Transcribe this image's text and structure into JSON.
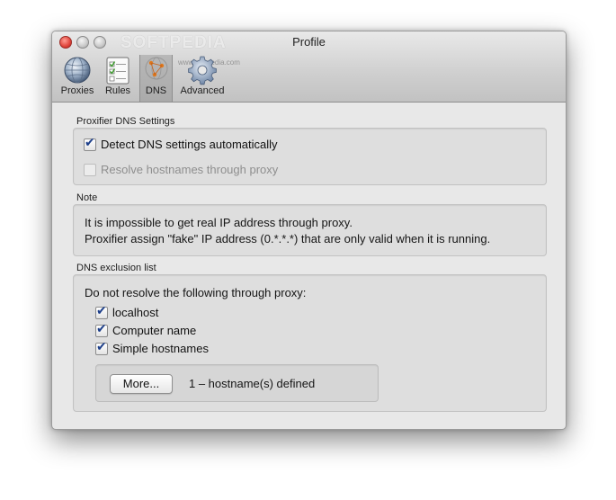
{
  "window": {
    "title": "Profile",
    "watermark": "SOFTPEDIA",
    "watermark_small": "www.softpedia.com"
  },
  "toolbar": {
    "items": [
      {
        "label": "Proxies",
        "icon": "globe-icon",
        "selected": false
      },
      {
        "label": "Rules",
        "icon": "checklist-icon",
        "selected": false
      },
      {
        "label": "DNS",
        "icon": "dns-icon",
        "selected": true
      },
      {
        "label": "Advanced",
        "icon": "gear-icon",
        "selected": false
      }
    ]
  },
  "dns_settings": {
    "title": "Proxifier DNS Settings",
    "detect": {
      "label": "Detect DNS settings automatically",
      "checked": true
    },
    "resolve": {
      "label": "Resolve hostnames through proxy",
      "checked": false,
      "disabled": true
    }
  },
  "note": {
    "title": "Note",
    "line1": "It is impossible to get real IP address through proxy.",
    "line2": "Proxifier assign \"fake\" IP address (0.*.*.*) that are only valid when it is running."
  },
  "exclusion": {
    "title": "DNS exclusion list",
    "intro": "Do not resolve the following through proxy:",
    "options": [
      {
        "label": "localhost",
        "checked": true
      },
      {
        "label": "Computer name",
        "checked": true
      },
      {
        "label": "Simple hostnames",
        "checked": true
      }
    ],
    "more_button": "More...",
    "status": "1 – hostname(s) defined"
  },
  "colors": {
    "check_mark": "#1d3f8a",
    "close_button": "#e0443b"
  }
}
